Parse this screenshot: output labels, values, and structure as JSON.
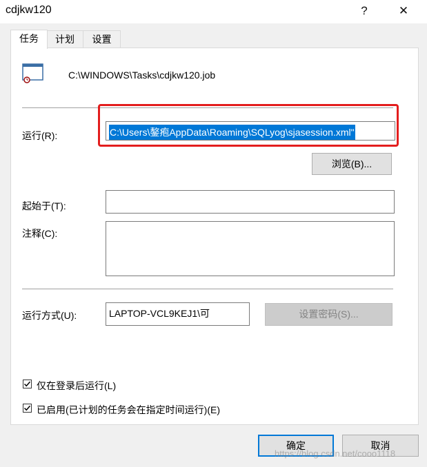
{
  "window": {
    "title": "cdjkw120",
    "help_glyph": "?",
    "close_glyph": "✕"
  },
  "tabs": [
    {
      "label": "任务"
    },
    {
      "label": "计划"
    },
    {
      "label": "设置"
    }
  ],
  "task": {
    "path": "C:\\WINDOWS\\Tasks\\cdjkw120.job"
  },
  "run": {
    "label": "运行(R):",
    "value": "C:\\Users\\鏊疱AppData\\Roaming\\SQLyog\\sjasession.xml\""
  },
  "browse_button": "浏览(B)...",
  "start_in": {
    "label": "起始于(T):",
    "value": ""
  },
  "comment": {
    "label": "注释(C):",
    "value": ""
  },
  "run_as": {
    "label": "运行方式(U):",
    "value": "LAPTOP-VCL9KEJ1\\可"
  },
  "set_password_button": "设置密码(S)...",
  "checkboxes": [
    {
      "label": "仅在登录后运行(L)",
      "checked": true
    },
    {
      "label": "已启用(已计划的任务会在指定时间运行)(E)",
      "checked": true
    }
  ],
  "ok_button": "确定",
  "cancel_button": "取消",
  "watermark": "https://blog.csdn.net/cooo1118",
  "colors": {
    "highlight": "#e31d1d",
    "selection": "#0078d7",
    "default_button_border": "#0078d7"
  }
}
